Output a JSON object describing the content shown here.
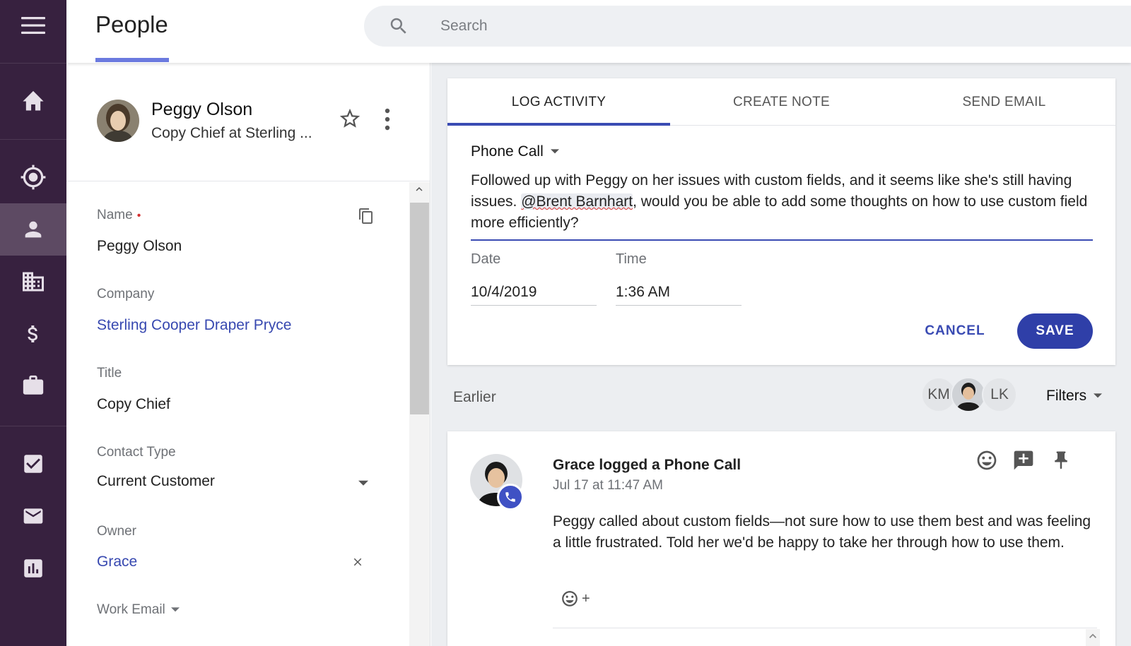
{
  "nav": {
    "items": [
      "menu",
      "home",
      "leads",
      "people",
      "companies",
      "opportunities",
      "projects",
      "tasks",
      "email",
      "reports"
    ],
    "active": "people"
  },
  "header": {
    "title": "People",
    "search_placeholder": "Search"
  },
  "profile": {
    "name": "Peggy Olson",
    "subtitle": "Copy Chief at Sterling ..."
  },
  "fields": {
    "name_label": "Name",
    "required_marker": "•",
    "name_value": "Peggy Olson",
    "company_label": "Company",
    "company_value": "Sterling Cooper Draper Pryce",
    "title_label": "Title",
    "title_value": "Copy Chief",
    "contact_type_label": "Contact Type",
    "contact_type_value": "Current Customer",
    "owner_label": "Owner",
    "owner_value": "Grace",
    "work_email_label": "Work Email"
  },
  "compose": {
    "tabs": [
      "LOG ACTIVITY",
      "CREATE NOTE",
      "SEND EMAIL"
    ],
    "active_tab": "LOG ACTIVITY",
    "activity_type": "Phone Call",
    "text_before": "Followed up with Peggy on her issues with custom fields, and it seems like she's still having issues. ",
    "mention": "@Brent Barnhart",
    "text_after": ", would you be able to add some thoughts on how to use custom field more efficiently?",
    "date_label": "Date",
    "date_value": "10/4/2019",
    "time_label": "Time",
    "time_value": "1:36 AM",
    "cancel_label": "CANCEL",
    "save_label": "SAVE"
  },
  "feed": {
    "section_label": "Earlier",
    "facepile": [
      "KM",
      "",
      "LK"
    ],
    "filters_label": "Filters",
    "entry": {
      "title": "Grace logged a Phone Call",
      "time": "Jul 17 at 11:47 AM",
      "body": "Peggy called about custom fields—not sure how to use them best and was feeling a little frustrated. Told her we'd be happy to take her through how to use them.",
      "react_plus": "+"
    }
  },
  "colors": {
    "nav_bg": "#37213f",
    "nav_active": "#5d4a63",
    "accent": "#3a4bb3",
    "link": "#3748b0",
    "required": "#d32f2f"
  }
}
